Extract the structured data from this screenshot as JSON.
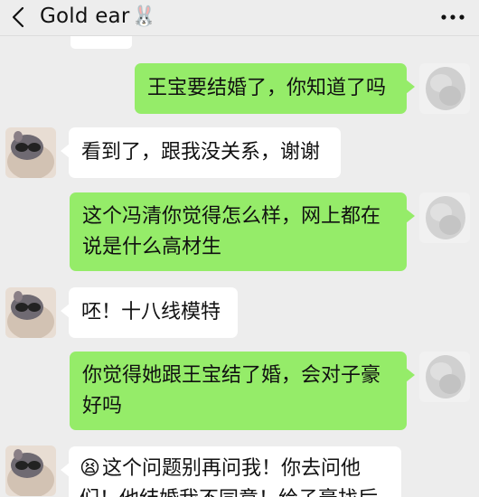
{
  "header": {
    "title": "Gold ear",
    "title_emoji": "🐰",
    "back_icon": "chevron-left-icon",
    "more_icon": "more-dots-icon"
  },
  "colors": {
    "background": "#ededed",
    "outgoing_bubble": "#95ec69",
    "incoming_bubble": "#ffffff"
  },
  "messages": [
    {
      "sender": "self",
      "text": "王宝要结婚了，你知道了吗"
    },
    {
      "sender": "other",
      "text": "看到了，跟我没关系，谢谢"
    },
    {
      "sender": "self",
      "lines": [
        "这个冯清你觉得怎么样，网上都在",
        "说是什么高材生"
      ]
    },
    {
      "sender": "other",
      "text": "呸！十八线模特"
    },
    {
      "sender": "self",
      "lines": [
        "你觉得她跟王宝结了婚，会对子豪",
        "好吗"
      ]
    },
    {
      "sender": "other",
      "emoji": "😫",
      "lines": [
        "这个问题别再问我！你去问他",
        "们！他结婚我不同意！给子豪找后"
      ]
    }
  ]
}
